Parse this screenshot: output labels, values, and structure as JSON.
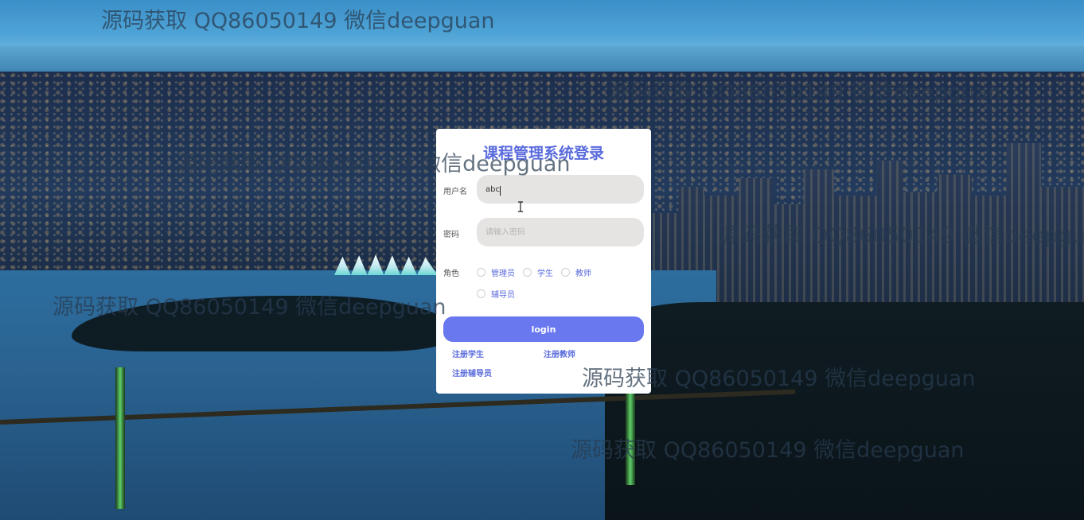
{
  "watermark_text": "源码获取 QQ86050149 微信deepguan",
  "login": {
    "title": "课程管理系统登录",
    "username_label": "用户名",
    "username_value": "abc",
    "password_label": "密码",
    "password_placeholder": "请输入密码",
    "role_label": "角色",
    "roles": [
      "管理员",
      "学生",
      "教师",
      "辅导员"
    ],
    "login_button": "login",
    "links": [
      "注册学生",
      "注册教师",
      "注册辅导员"
    ]
  },
  "colors": {
    "accent": "#5a6bdc",
    "button": "#6a78f0",
    "input_bg": "#e6e3e3"
  }
}
